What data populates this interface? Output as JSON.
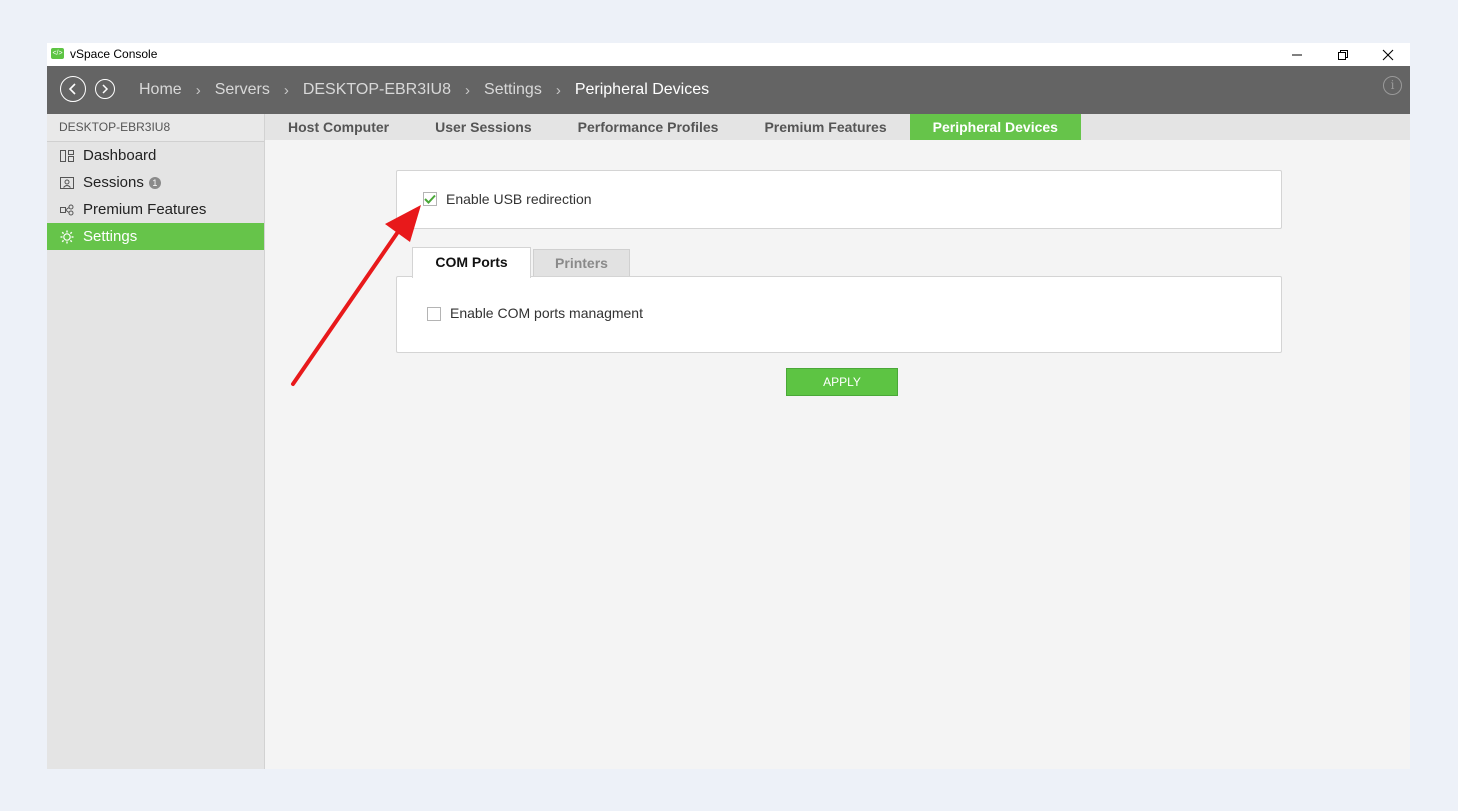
{
  "window": {
    "title": "vSpace Console",
    "controls": [
      "minimize-icon",
      "restore-icon",
      "close-icon"
    ]
  },
  "header": {
    "breadcrumbs": [
      "Home",
      "Servers",
      "DESKTOP-EBR3IU8",
      "Settings",
      "Peripheral Devices"
    ],
    "separator": "›"
  },
  "sidebar": {
    "server_name": "DESKTOP-EBR3IU8",
    "items": [
      {
        "label": "Dashboard",
        "icon": "dashboard-icon"
      },
      {
        "label": "Sessions",
        "icon": "sessions-icon",
        "badge": "1"
      },
      {
        "label": "Premium Features",
        "icon": "premium-features-icon"
      },
      {
        "label": "Settings",
        "icon": "settings-icon",
        "active": true
      }
    ]
  },
  "tabs": [
    {
      "label": "Host Computer"
    },
    {
      "label": "User Sessions"
    },
    {
      "label": "Performance Profiles"
    },
    {
      "label": "Premium Features"
    },
    {
      "label": "Peripheral Devices",
      "active": true
    }
  ],
  "content": {
    "usb_redirection": {
      "label": "Enable USB redirection",
      "checked": true
    },
    "subtabs": [
      {
        "label": "COM Ports",
        "active": true
      },
      {
        "label": "Printers"
      }
    ],
    "com_ports": {
      "label": "Enable COM ports managment",
      "checked": false
    },
    "apply_label": "APPLY"
  },
  "colors": {
    "accent_green": "#66c44a",
    "header_gray": "#646464",
    "annotation_arrow": "#e8191b"
  }
}
